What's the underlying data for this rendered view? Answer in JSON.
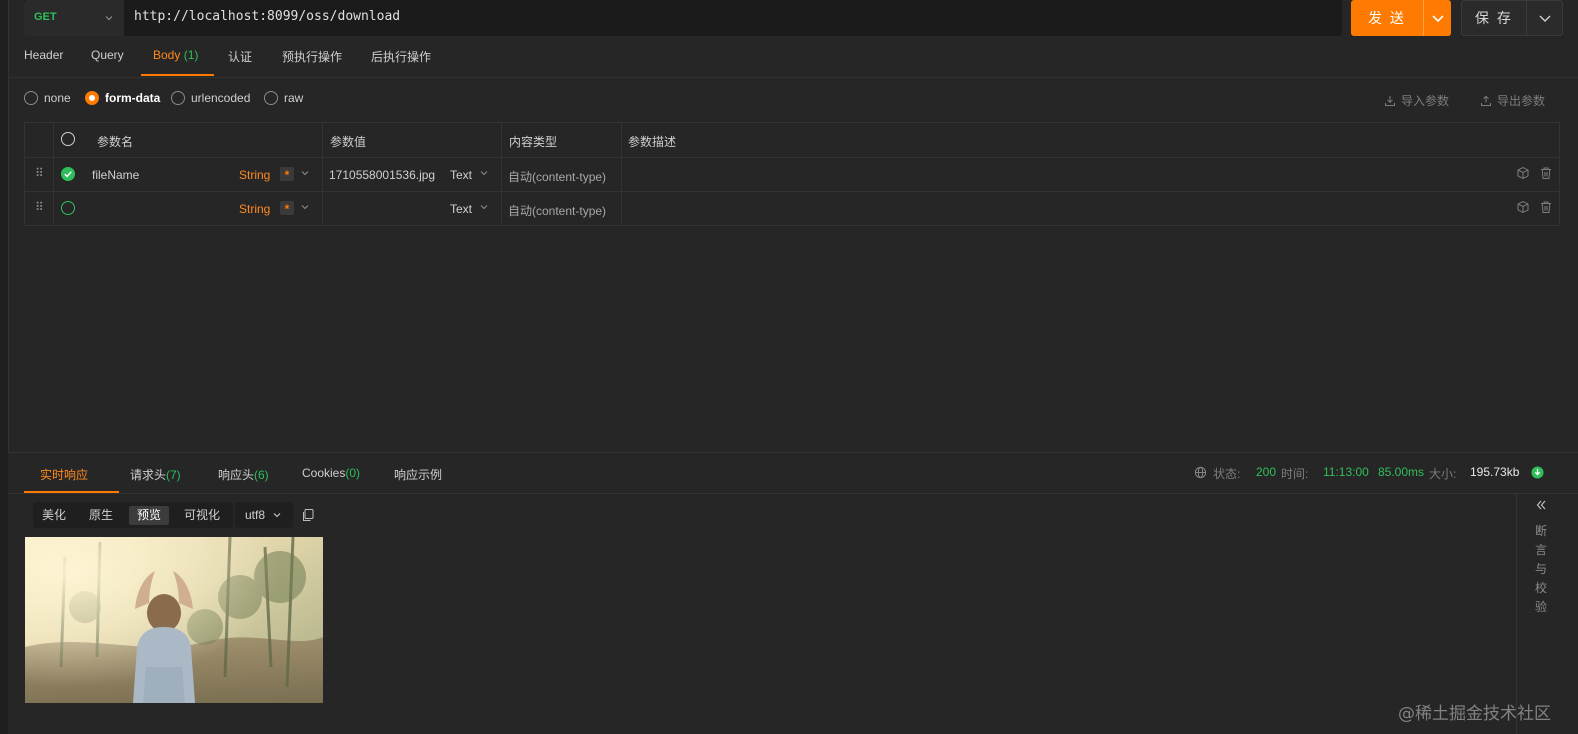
{
  "request": {
    "method": "GET",
    "url": "http://localhost:8099/oss/download",
    "send_label": "发 送",
    "save_label": "保 存"
  },
  "request_tabs": [
    {
      "label": "Header"
    },
    {
      "label": "Query"
    },
    {
      "label": "Body",
      "count": "(1)"
    },
    {
      "label": "认证"
    },
    {
      "label": "预执行操作"
    },
    {
      "label": "后执行操作"
    }
  ],
  "body_types": {
    "options": [
      "none",
      "form-data",
      "urlencoded",
      "raw"
    ],
    "selected": "form-data",
    "import_label": "导入参数",
    "export_label": "导出参数"
  },
  "params_table": {
    "headers": [
      "参数名",
      "参数值",
      "内容类型",
      "参数描述"
    ],
    "rows": [
      {
        "checked": true,
        "name": "fileName",
        "type": "String",
        "required": "*",
        "value": "1710558001536.jpg",
        "value_type": "Text",
        "content_type": "自动(content-type)",
        "description": ""
      },
      {
        "checked": false,
        "name": "",
        "type": "String",
        "required": "*",
        "value": "",
        "value_type": "Text",
        "content_type": "自动(content-type)",
        "description": ""
      }
    ]
  },
  "response_tabs": [
    {
      "label": "实时响应"
    },
    {
      "label": "请求头",
      "count": "(7)"
    },
    {
      "label": "响应头",
      "count": "(6)"
    },
    {
      "label": "Cookies",
      "count": "(0)"
    },
    {
      "label": "响应示例"
    }
  ],
  "response_status": {
    "status_label": "状态:",
    "status_value": "200",
    "time_label": "时间:",
    "time_value": "11:13:00",
    "duration": "85.00ms",
    "size_label": "大小:",
    "size_value": "195.73kb"
  },
  "view_modes": {
    "options": [
      "美化",
      "原生",
      "预览",
      "可视化"
    ],
    "selected": "预览",
    "encoding": "utf8"
  },
  "side_panel": {
    "chars": [
      "断",
      "言",
      "与",
      "校",
      "验"
    ]
  },
  "watermark": "@稀土掘金技术社区",
  "colors": {
    "accent": "#ff7a00",
    "success": "#2fbf5a",
    "background": "#262626"
  }
}
